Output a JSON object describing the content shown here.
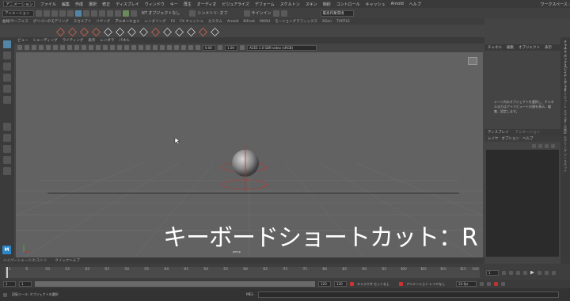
{
  "menubar": {
    "mode": "アニメーション",
    "items": [
      "ファイル",
      "編集",
      "作成",
      "選択",
      "修正",
      "ディスプレイ",
      "ウィンドウ",
      "キー",
      "再生",
      "オーディオ",
      "ビジュアライズ",
      "デフォーム",
      "スケルトン",
      "スキン",
      "制約",
      "コントロール",
      "キャッシュ",
      "Arnold",
      "ヘルプ"
    ]
  },
  "workspace": {
    "label": "ワークスペース :",
    "value": "最高作業環境"
  },
  "toolbar": {
    "no_object": "NT オブジェクトなし",
    "symmetry": "シンメトリ: オフ",
    "sign_in": "サインイン"
  },
  "shelf_tabs": [
    "曲線/サーフェス",
    "ポリゴンのモデリング",
    "スカルプト",
    "リギング",
    "アニメーション",
    "レンダリング",
    "FX",
    "FX キャッシュ",
    "カスタム",
    "Arnold",
    "Bifrost",
    "MASH",
    "モーショングラフィックス",
    "XGen",
    "TURTLE"
  ],
  "shelf_active": "アニメーション",
  "panel_menu": [
    "ビュー",
    "シェーディング",
    "ライティング",
    "表示",
    "レンダラ",
    "パネル"
  ],
  "panel_fields": {
    "exposure": "0.00",
    "gamma": "1.00",
    "colorspace": "ACES 1.0 SDR-video (sRGB)"
  },
  "viewport": {
    "camera": "persp",
    "caption": "キーボードショートカット：R"
  },
  "channel_box": {
    "menu": [
      "チャネル",
      "編集",
      "オブジェクト",
      "表示"
    ],
    "info": "シーン内のオブジェクトを選択し、チャネルまたはアトリビュートの値を表示、編集、設定します。"
  },
  "layer_editor": {
    "tabs": [
      "ディスプレイ",
      "アニメーション"
    ],
    "menu": [
      "レイヤ",
      "オプション",
      "ヘルプ"
    ]
  },
  "bottom_tabs": [
    "ハイパーシェード/ヒストリ",
    "クイックヘルプ"
  ],
  "timeline": {
    "ticks": [
      "1",
      "5",
      "10",
      "15",
      "20",
      "25",
      "30",
      "35",
      "40",
      "45",
      "50",
      "55",
      "60",
      "65",
      "70",
      "75",
      "80",
      "85",
      "90",
      "95",
      "100",
      "105",
      "110",
      "115",
      "120"
    ],
    "current": "1"
  },
  "range": {
    "start": "1",
    "inner_start": "1",
    "inner_end": "120",
    "end": "120",
    "fps": "24 fps",
    "char_set": "キャラクタ セットなし",
    "anim_layer": "アニメーション レイヤなし"
  },
  "cmdline": {
    "lang": "MEL",
    "status": "回転ツール: オブジェクトの選択"
  },
  "right_strip": [
    "チャネル ボックス/レイヤ エディタ",
    "アトリビュート エディタ",
    "ツール設定",
    "モデリング ツールキット"
  ],
  "logo": "M"
}
